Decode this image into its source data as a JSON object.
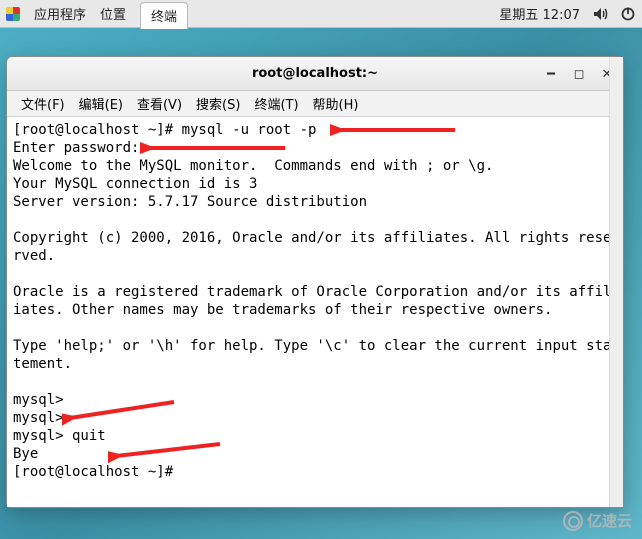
{
  "topbar": {
    "apps_label": "应用程序",
    "places_label": "位置",
    "active_tab": "终端",
    "clock": "星期五 12:07"
  },
  "window": {
    "title": "root@localhost:~",
    "menu": {
      "file": "文件(F)",
      "edit": "编辑(E)",
      "view": "查看(V)",
      "search": "搜索(S)",
      "terminal": "终端(T)",
      "help": "帮助(H)"
    }
  },
  "terminal": {
    "lines": [
      "[root@localhost ~]# mysql -u root -p",
      "Enter password: ",
      "Welcome to the MySQL monitor.  Commands end with ; or \\g.",
      "Your MySQL connection id is 3",
      "Server version: 5.7.17 Source distribution",
      "",
      "Copyright (c) 2000, 2016, Oracle and/or its affiliates. All rights reserved.",
      "",
      "Oracle is a registered trademark of Oracle Corporation and/or its affiliates. Other names may be trademarks of their respective owners.",
      "",
      "Type 'help;' or '\\h' for help. Type '\\c' to clear the current input statement.",
      "",
      "mysql> ",
      "mysql> ",
      "mysql> quit",
      "Bye",
      "[root@localhost ~]# "
    ]
  },
  "watermark": {
    "text": "亿速云"
  }
}
